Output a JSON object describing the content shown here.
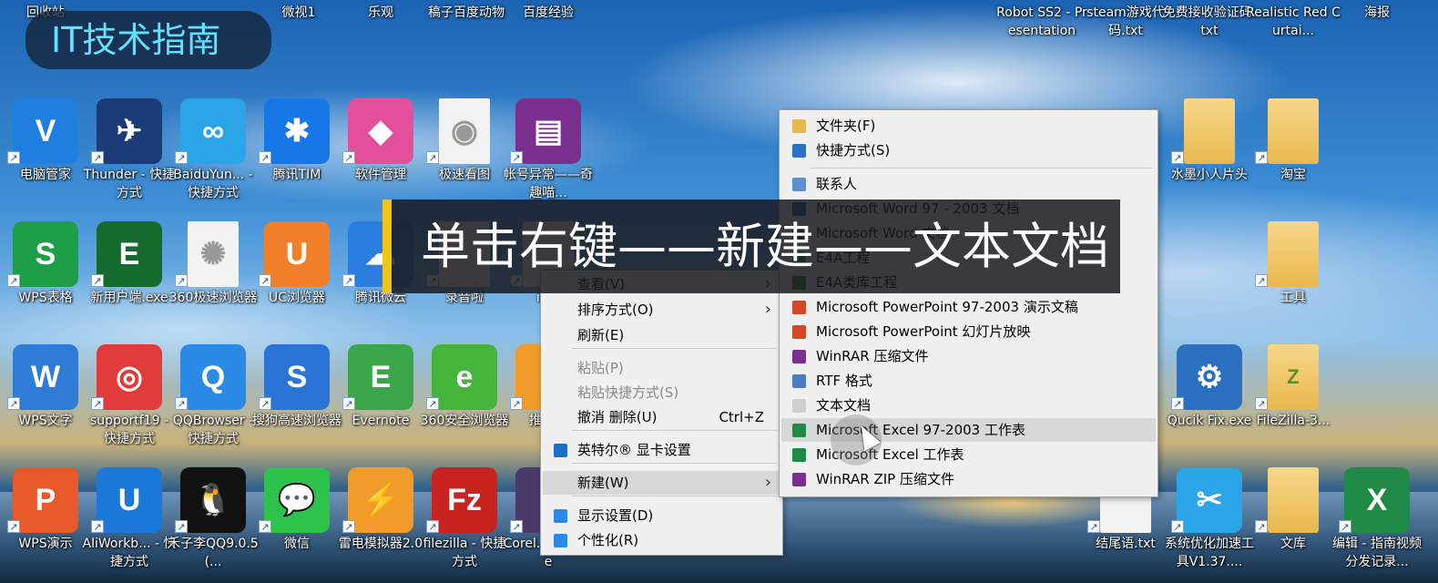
{
  "brand": "IT技术指南",
  "caption": "单击右键——新建——文本文档",
  "desktop_icons": [
    {
      "label": "回收站",
      "glyph": "♻",
      "color": "#5ea0d8",
      "kind": "top"
    },
    {
      "label": "微视1",
      "glyph": "",
      "color": "#f2f2f2",
      "kind": "top"
    },
    {
      "label": "乐观",
      "glyph": "",
      "color": "#f2f2f2",
      "kind": "top"
    },
    {
      "label": "稿子百度动物",
      "glyph": "",
      "color": "#f2f2f2",
      "kind": "top"
    },
    {
      "label": "百度经验",
      "glyph": "",
      "color": "#f2f2f2",
      "kind": "top"
    },
    {
      "label": "Robot SS2 - Presentation",
      "glyph": "",
      "color": "#f2f2f2",
      "kind": "top"
    },
    {
      "label": "steam游戏代码.txt",
      "glyph": "",
      "color": "#f2f2f2",
      "kind": "top"
    },
    {
      "label": "免费接收验证码.txt",
      "glyph": "",
      "color": "#f2f2f2",
      "kind": "top"
    },
    {
      "label": "Realistic Red Curtai...",
      "glyph": "♪",
      "color": "#2c6bb0",
      "kind": "top"
    },
    {
      "label": "海报",
      "glyph": "",
      "color": "#f2f2f2",
      "kind": "top"
    },
    {
      "label": "电脑管家",
      "glyph": "V",
      "color": "#1e7fe0"
    },
    {
      "label": "Thunder - 快捷方式",
      "glyph": "✈",
      "color": "#1b3c78"
    },
    {
      "label": "BaiduYun... - 快捷方式",
      "glyph": "∞",
      "color": "#2aa6e8"
    },
    {
      "label": "腾讯TIM",
      "glyph": "✱",
      "color": "#1877e6"
    },
    {
      "label": "软件管理",
      "glyph": "◆",
      "color": "#e24f9a"
    },
    {
      "label": "极速看图",
      "glyph": "◉",
      "color": "#f2f2f2"
    },
    {
      "label": "帐号异常——奇趣喵...",
      "glyph": "▤",
      "color": "#7a2f8e"
    },
    {
      "label": "水墨小人片头",
      "glyph": "",
      "color": "#e9b84d"
    },
    {
      "label": "淘宝",
      "glyph": "",
      "color": "#e9b84d"
    },
    {
      "label": "WPS表格",
      "glyph": "S",
      "color": "#1f9e48"
    },
    {
      "label": "新用户端.exe",
      "glyph": "E",
      "color": "#156b2e"
    },
    {
      "label": "360极速浏览器",
      "glyph": "✺",
      "color": "#f2f2f2"
    },
    {
      "label": "UC浏览器",
      "glyph": "U",
      "color": "#f2802a"
    },
    {
      "label": "腾讯微云",
      "glyph": "☁",
      "color": "#2b7ee0"
    },
    {
      "label": "录音啦",
      "glyph": "",
      "color": "#f2f2f2"
    },
    {
      "label": "ima",
      "glyph": "",
      "color": "#f2f2f2"
    },
    {
      "label": "工具",
      "glyph": "",
      "color": "#e9b84d"
    },
    {
      "label": "WPS文字",
      "glyph": "W",
      "color": "#2e7bd8"
    },
    {
      "label": "supportf19 - 快捷方式",
      "glyph": "◎",
      "color": "#e23b3b"
    },
    {
      "label": "QQBrowser - 快捷方式",
      "glyph": "Q",
      "color": "#2a8ae6"
    },
    {
      "label": "搜狗高速浏览器",
      "glyph": "S",
      "color": "#2a74d8"
    },
    {
      "label": "Evernote",
      "glyph": "E",
      "color": "#3aa64a"
    },
    {
      "label": "360安全浏览器",
      "glyph": "e",
      "color": "#45b43a"
    },
    {
      "label": "推客易",
      "glyph": "",
      "color": "#f29b2a"
    },
    {
      "label": "Qucik Fix.exe",
      "glyph": "⚙",
      "color": "#2a6fc0"
    },
    {
      "label": "FileZilla-3...",
      "glyph": "Z",
      "color": "#e9b84d"
    },
    {
      "label": "WPS演示",
      "glyph": "P",
      "color": "#e8592a"
    },
    {
      "label": "AliWorkb... - 快捷方式",
      "glyph": "U",
      "color": "#1c78d8"
    },
    {
      "label": "禾子李QQ9.0.5(...",
      "glyph": "🐧",
      "color": "#111111"
    },
    {
      "label": "微信",
      "glyph": "💬",
      "color": "#2dc24a"
    },
    {
      "label": "雷电模拟器2.0",
      "glyph": "⚡",
      "color": "#f29b2a"
    },
    {
      "label": "filezilla - 快捷方式",
      "glyph": "Fz",
      "color": "#c8231e"
    },
    {
      "label": "Corel...册机.exe",
      "glyph": "",
      "color": "#4a3a6a"
    },
    {
      "label": "结尾语.txt",
      "glyph": "",
      "color": "#f2f2f2"
    },
    {
      "label": "系统优化加速工具V1.37....",
      "glyph": "✂",
      "color": "#2aa6e8"
    },
    {
      "label": "文库",
      "glyph": "",
      "color": "#e9b84d"
    },
    {
      "label": "编辑 - 指南视频分发记录...",
      "glyph": "X",
      "color": "#1f8a46"
    }
  ],
  "context_menu": {
    "items": [
      {
        "label": "查看(V)",
        "shortcut": "",
        "submenu": true,
        "disabled": false
      },
      {
        "label": "排序方式(O)",
        "shortcut": "",
        "submenu": true,
        "disabled": false
      },
      {
        "label": "刷新(E)",
        "shortcut": "",
        "submenu": false,
        "disabled": false
      },
      {
        "label": "粘贴(P)",
        "shortcut": "",
        "submenu": false,
        "disabled": true
      },
      {
        "label": "粘贴快捷方式(S)",
        "shortcut": "",
        "submenu": false,
        "disabled": true
      },
      {
        "label": "撤消 删除(U)",
        "shortcut": "Ctrl+Z",
        "submenu": false,
        "disabled": false
      },
      {
        "label": "英特尔® 显卡设置",
        "shortcut": "",
        "submenu": false,
        "disabled": false
      },
      {
        "label": "新建(W)",
        "shortcut": "",
        "submenu": true,
        "disabled": false,
        "highlighted": true
      },
      {
        "label": "显示设置(D)",
        "shortcut": "",
        "submenu": false,
        "disabled": false
      },
      {
        "label": "个性化(R)",
        "shortcut": "",
        "submenu": false,
        "disabled": false
      }
    ]
  },
  "new_submenu": {
    "items": [
      {
        "label": "文件夹(F)",
        "icon": "folder-icon",
        "color": "#e9b84d"
      },
      {
        "label": "快捷方式(S)",
        "icon": "shortcut-icon",
        "color": "#2a6fc0"
      },
      {
        "label": "联系人",
        "icon": "contact-icon",
        "color": "#5a8fd0"
      },
      {
        "label": "Microsoft Word 97 - 2003 文档",
        "icon": "word-icon",
        "color": "#2b5faa"
      },
      {
        "label": "Microsoft Word 文档",
        "icon": "word-icon",
        "color": "#2b5faa"
      },
      {
        "label": "E4A工程",
        "icon": "e4a-icon",
        "color": "#2f8a3e"
      },
      {
        "label": "E4A类库工程",
        "icon": "e4a-icon",
        "color": "#2f8a3e"
      },
      {
        "label": "Microsoft PowerPoint 97-2003 演示文稿",
        "icon": "ppt-icon",
        "color": "#d24726"
      },
      {
        "label": "Microsoft PowerPoint 幻灯片放映",
        "icon": "ppt-icon",
        "color": "#d24726"
      },
      {
        "label": "WinRAR 压缩文件",
        "icon": "rar-icon",
        "color": "#7a2f8e"
      },
      {
        "label": "RTF 格式",
        "icon": "rtf-icon",
        "color": "#4a7ac8"
      },
      {
        "label": "文本文档",
        "icon": "text-file-icon",
        "color": "#cfcfcf"
      },
      {
        "label": "Microsoft Excel 97-2003 工作表",
        "icon": "excel-icon",
        "color": "#1f8a46",
        "highlighted": true
      },
      {
        "label": "Microsoft Excel 工作表",
        "icon": "excel-icon",
        "color": "#1f8a46"
      },
      {
        "label": "WinRAR ZIP 压缩文件",
        "icon": "zip-icon",
        "color": "#7a2f8e"
      }
    ]
  }
}
